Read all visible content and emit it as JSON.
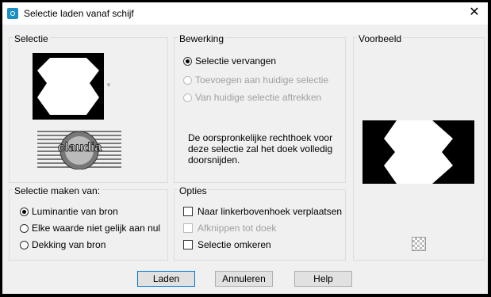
{
  "window": {
    "title": "Selectie laden vanaf schijf",
    "close": "✕"
  },
  "selectie": {
    "label": "Selectie"
  },
  "bewerking": {
    "label": "Bewerking",
    "options": [
      "Selectie vervangen",
      "Toevoegen aan huidige selectie",
      "Van huidige selectie aftrekken"
    ],
    "description": "De oorspronkelijke rechthoek voor deze selectie zal het doek volledig doorsnijden."
  },
  "voorbeeld": {
    "label": "Voorbeeld"
  },
  "selectie_maken": {
    "label": "Selectie maken van:",
    "options": [
      "Luminantie van bron",
      "Elke waarde niet gelijk aan nul",
      "Dekking van bron"
    ]
  },
  "opties": {
    "label": "Opties",
    "items": [
      "Naar linkerbovenhoek verplaatsen",
      "Afknippen tot doek",
      "Selectie omkeren"
    ]
  },
  "watermark": "claudia",
  "buttons": {
    "load": "Laden",
    "cancel": "Annuleren",
    "help": "Help"
  }
}
